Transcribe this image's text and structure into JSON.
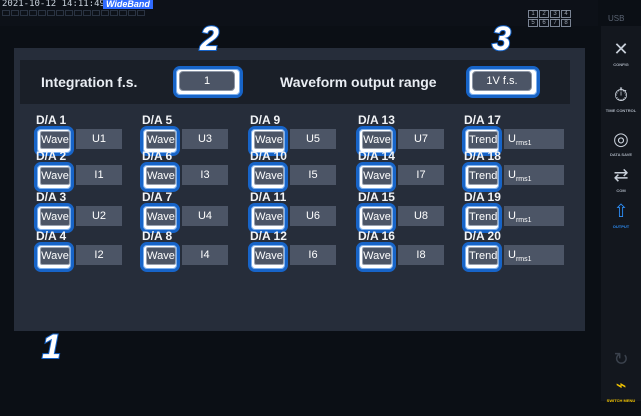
{
  "status": {
    "timestamp": "2021-10-12 14:11:49",
    "mode_badge": "WideBand",
    "wiring_grid": [
      "1",
      "2",
      "3",
      "4",
      "5",
      "6",
      "7",
      "8"
    ],
    "usb_label": "USB"
  },
  "settings": {
    "integration_label": "Integration f.s.",
    "integration_value": "1",
    "waveform_range_label": "Waveform output range",
    "waveform_range_value": "1V f.s."
  },
  "callouts": [
    "1",
    "2",
    "3"
  ],
  "channels": [
    {
      "name": "D/A 1",
      "mode": "Wave",
      "signal": "U1"
    },
    {
      "name": "D/A 2",
      "mode": "Wave",
      "signal": "I1"
    },
    {
      "name": "D/A 3",
      "mode": "Wave",
      "signal": "U2"
    },
    {
      "name": "D/A 4",
      "mode": "Wave",
      "signal": "I2"
    },
    {
      "name": "D/A 5",
      "mode": "Wave",
      "signal": "U3"
    },
    {
      "name": "D/A 6",
      "mode": "Wave",
      "signal": "I3"
    },
    {
      "name": "D/A 7",
      "mode": "Wave",
      "signal": "U4"
    },
    {
      "name": "D/A 8",
      "mode": "Wave",
      "signal": "I4"
    },
    {
      "name": "D/A 9",
      "mode": "Wave",
      "signal": "U5"
    },
    {
      "name": "D/A 10",
      "mode": "Wave",
      "signal": "I5"
    },
    {
      "name": "D/A 11",
      "mode": "Wave",
      "signal": "U6"
    },
    {
      "name": "D/A 12",
      "mode": "Wave",
      "signal": "I6"
    },
    {
      "name": "D/A 13",
      "mode": "Wave",
      "signal": "U7"
    },
    {
      "name": "D/A 14",
      "mode": "Wave",
      "signal": "I7"
    },
    {
      "name": "D/A 15",
      "mode": "Wave",
      "signal": "U8"
    },
    {
      "name": "D/A 16",
      "mode": "Wave",
      "signal": "I8"
    },
    {
      "name": "D/A 17",
      "mode": "Trend",
      "signal": "U",
      "signal_sub": "rms1"
    },
    {
      "name": "D/A 18",
      "mode": "Trend",
      "signal": "U",
      "signal_sub": "rms1"
    },
    {
      "name": "D/A 19",
      "mode": "Trend",
      "signal": "U",
      "signal_sub": "rms1"
    },
    {
      "name": "D/A 20",
      "mode": "Trend",
      "signal": "U",
      "signal_sub": "rms1"
    }
  ],
  "sidebar": [
    {
      "label": "CONFIG",
      "icon": "tools-icon"
    },
    {
      "label": "TIME CONTROL",
      "icon": "stopwatch-icon"
    },
    {
      "label": "DATA SAVE",
      "icon": "disk-icon"
    },
    {
      "label": "COM",
      "icon": "transfer-icon"
    },
    {
      "label": "OUTPUT",
      "icon": "export-icon"
    },
    {
      "label": "",
      "icon": "disabled-icon"
    },
    {
      "label": "SWITCH MENU",
      "icon": "switch-icon"
    }
  ],
  "colors": {
    "accent": "#1764c8",
    "active_menu": "#2d8df5",
    "switch_menu": "#f2c400",
    "panel": "#262d3a"
  }
}
